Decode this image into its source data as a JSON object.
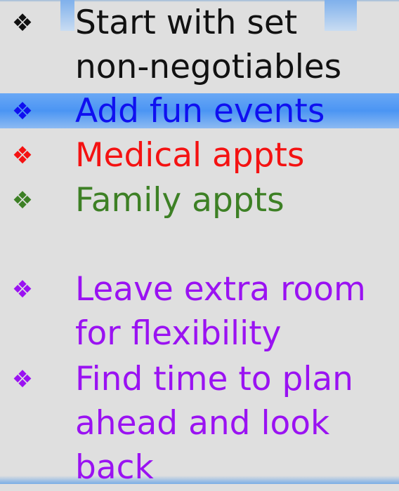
{
  "bullets": [
    {
      "marker": "❖",
      "lines": [
        "Start with set",
        "non-negotiables"
      ],
      "color": "#111111"
    },
    {
      "marker": "❖",
      "lines": [
        "Add fun events"
      ],
      "color": "#0f10f0"
    },
    {
      "marker": "❖",
      "lines": [
        "Medical appts"
      ],
      "color": "#f41212"
    },
    {
      "marker": "❖",
      "lines": [
        "Family appts"
      ],
      "color": "#3d8025"
    },
    {
      "marker": "❖",
      "lines": [
        "Leave extra room",
        "for flexibility"
      ],
      "color": "#9a12f2"
    },
    {
      "marker": "❖",
      "lines": [
        "Find time to plan",
        "ahead and look",
        "back"
      ],
      "color": "#9a12f2"
    }
  ],
  "highlight_color": "#4b95f3"
}
